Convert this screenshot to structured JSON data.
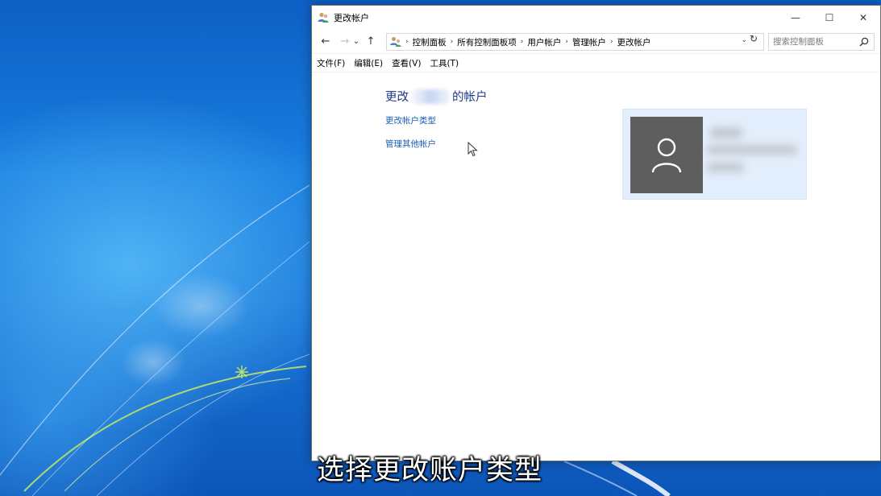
{
  "window": {
    "title": "更改帐户",
    "controls": {
      "minimize": "—",
      "maximize": "☐",
      "close": "✕"
    }
  },
  "nav": {
    "back": "←",
    "forward": "→",
    "recent": "⌄",
    "up": "↑",
    "breadcrumb": [
      "控制面板",
      "所有控制面板项",
      "用户帐户",
      "管理帐户",
      "更改帐户"
    ],
    "separator": "›",
    "dropdown": "⌄",
    "refresh": "↻"
  },
  "search": {
    "placeholder": "搜索控制面板"
  },
  "menu": {
    "file": "文件(F)",
    "edit": "编辑(E)",
    "view": "查看(V)",
    "tools": "工具(T)"
  },
  "content": {
    "heading_prefix": "更改",
    "heading_suffix": "的帐户",
    "links": {
      "change_type": "更改帐户类型",
      "manage_others": "管理其他帐户"
    }
  },
  "subtitle": "选择更改账户类型",
  "colors": {
    "link": "#1a5fb4",
    "heading": "#1e3a8a",
    "card_bg": "#e3eefc",
    "avatar_bg": "#5e5e5e"
  },
  "icons": {
    "app": "users-icon",
    "control_panel": "control-panel-icon",
    "search": "search-icon",
    "avatar": "user-silhouette-icon",
    "cursor": "mouse-cursor-icon"
  }
}
